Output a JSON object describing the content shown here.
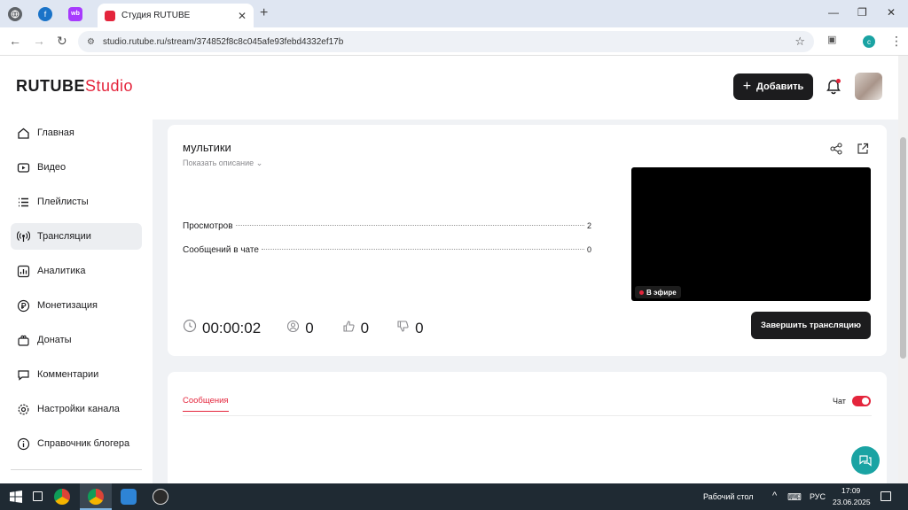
{
  "browser": {
    "tab_title": "Студия RUTUBE",
    "url": "studio.rutube.ru/stream/374852f8c8c045afe93febd4332ef17b",
    "profile_letter": "c"
  },
  "header": {
    "logo_main": "RUTUBE",
    "logo_sub": "Studio",
    "add_label": "Добавить"
  },
  "sidebar": {
    "items": [
      {
        "label": "Главная",
        "icon": "home-icon"
      },
      {
        "label": "Видео",
        "icon": "video-icon"
      },
      {
        "label": "Плейлисты",
        "icon": "playlist-icon"
      },
      {
        "label": "Трансляции",
        "icon": "broadcast-icon",
        "active": true
      },
      {
        "label": "Аналитика",
        "icon": "analytics-icon"
      },
      {
        "label": "Монетизация",
        "icon": "ruble-icon"
      },
      {
        "label": "Донаты",
        "icon": "gift-icon"
      },
      {
        "label": "Комментарии",
        "icon": "comments-icon"
      },
      {
        "label": "Настройки канала",
        "icon": "gear-icon"
      },
      {
        "label": "Справочник блогера",
        "icon": "info-icon"
      }
    ]
  },
  "stream": {
    "title": "мультики",
    "show_description": "Показать описание",
    "stats": [
      {
        "label": "Просмотров",
        "value": "2"
      },
      {
        "label": "Сообщений в чате",
        "value": "0"
      }
    ],
    "live_badge": "В эфире",
    "duration": "00:00:02",
    "viewers": "0",
    "likes": "0",
    "dislikes": "0",
    "end_button": "Завершить трансляцию"
  },
  "chat": {
    "tab_label": "Сообщения",
    "toggle_label": "Чат",
    "enabled": true
  },
  "taskbar": {
    "desktop_label": "Рабочий стол",
    "lang": "РУС",
    "time": "17:09",
    "date": "23.06.2025"
  },
  "colors": {
    "accent": "#e4253c",
    "dark": "#1c1c1e",
    "help": "#1aa3a3"
  }
}
